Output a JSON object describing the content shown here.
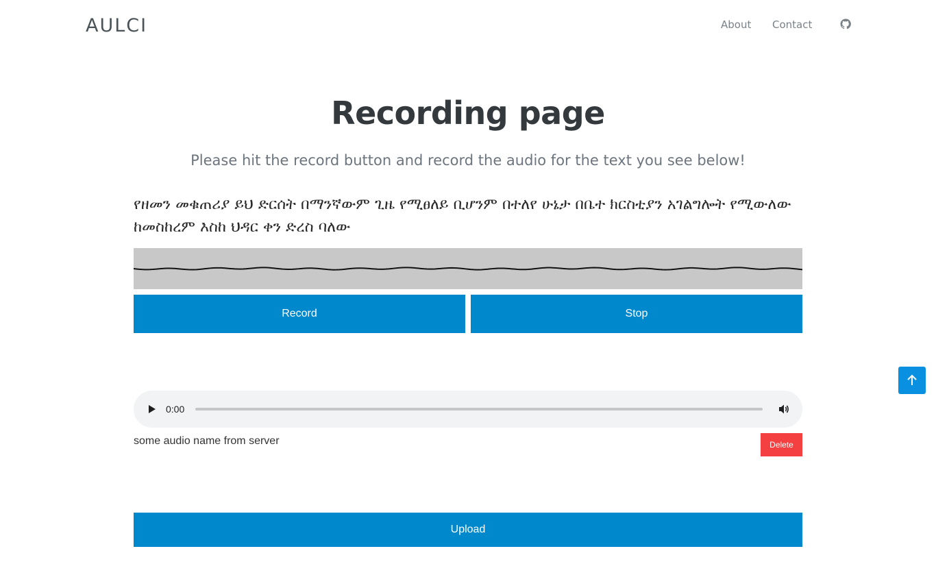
{
  "navbar": {
    "brand": "AULCI",
    "links": [
      {
        "label": "About"
      },
      {
        "label": "Contact"
      }
    ],
    "github_icon": "github-icon"
  },
  "main": {
    "title": "Recording page",
    "subtitle": "Please hit the record button and record the audio for the text you see below!",
    "prompt_text": "የዘመን መቁጠሪያ ይህ ድርሰት በማንኛውም ጊዜ የሚፀለይ ቢሆንም በተለየ ሁኔታ በቤተ ክርስቲያን አገልግሎት የሚውለው ከመስከረም እስከ ህዳር ቀን ድረስ ባለው",
    "record_label": "Record",
    "stop_label": "Stop",
    "upload_label": "Upload"
  },
  "audio": {
    "time": "0:00",
    "name": "some audio name from server",
    "delete_label": "Delete",
    "progress": 0
  },
  "icons": {
    "play": "play-icon",
    "volume": "volume-icon",
    "scroll_top": "arrow-up-icon"
  },
  "colors": {
    "primary": "#0088cc",
    "danger": "#f44040",
    "waveform_bg": "#c8c8c8",
    "scroll_top": "#0a90e0"
  }
}
